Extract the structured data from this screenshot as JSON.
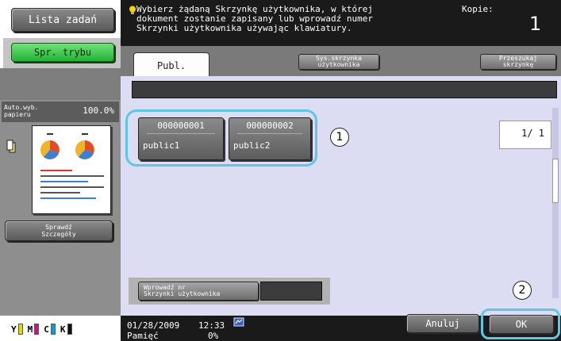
{
  "left_panel": {
    "job_list_label": "Lista zadań",
    "mode_check_label": "Spr. trybu",
    "paper_label": "Auto.wyb. papieru",
    "zoom_value": "100.0%",
    "details_label_line1": "Sprawdź",
    "details_label_line2": "Szczegóły",
    "toner": [
      {
        "letter": "Y",
        "color": "#e8d800"
      },
      {
        "letter": "M",
        "color": "#d0108a"
      },
      {
        "letter": "C",
        "color": "#00a0e0"
      },
      {
        "letter": "K",
        "color": "#111111"
      }
    ]
  },
  "header": {
    "message_line1": "Wybierz żądaną Skrzynkę użytkownika, w której",
    "message_line2": "dokument zostanie zapisany lub wprowadź numer",
    "message_line3": "Skrzynki użytkownika używając klawiatury.",
    "copies_label": "Kopie:",
    "copies_value": "1"
  },
  "tabs": {
    "public": "Publ.",
    "system_line1": "Sys.skrzynka",
    "system_line2": "użytkownika",
    "search_line1": "Przeszukaj",
    "search_line2": "skrzynkę"
  },
  "boxes": [
    {
      "number": "000000001",
      "name": "public1"
    },
    {
      "number": "000000002",
      "name": "public2"
    }
  ],
  "pagination": "1/  1",
  "enter_box": {
    "line1": "Wprowadź nr",
    "line2": "Skrzynki użytkownika"
  },
  "callouts": {
    "first": "1",
    "second": "2"
  },
  "status": {
    "date": "01/28/2009",
    "time": "12:33",
    "memory_label": "Pamięć",
    "memory_value": "0%"
  },
  "actions": {
    "cancel": "Anuluj",
    "ok": "OK"
  },
  "colors": {
    "highlight": "#5ec7e6",
    "accent_green": "#22b336",
    "content_bg": "#dcdcf2"
  }
}
